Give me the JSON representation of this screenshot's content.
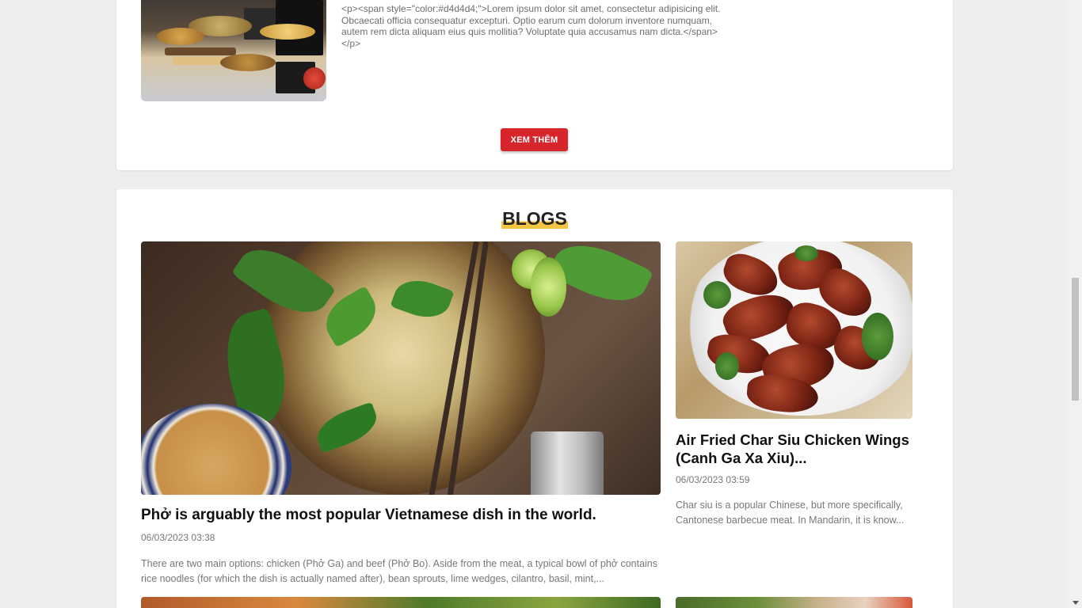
{
  "intro": {
    "text": "<p><span style=\"color:#d4d4d4;\">Lorem ipsum dolor sit amet, consectetur adipisicing elit. Obcaecati officia consequatur excepturi. Optio earum cum dolorum inventore numquam, autem rem dicta aliquam eius quis mollitia? Voluptate quia accusamus nam dicta.</span></p>",
    "more_label": "XEM THÊM"
  },
  "blogs": {
    "heading": "BLOGS",
    "featured": {
      "title": "Phở is arguably the most popular Vietnamese dish in the world.",
      "date": "06/03/2023 03:38",
      "excerpt": "There are two main options: chicken (Phở Ga) and beef (Phở Bo). Aside from the meat, a typical bowl of phở contains rice noodles (for which the dish is actually named after), bean sprouts, lime wedges, cilantro, basil, mint,..."
    },
    "side": {
      "title": "Air Fried Char Siu Chicken Wings (Canh Ga Xa Xiu)...",
      "date": "06/03/2023 03:59",
      "excerpt": "Char siu is a popular Chinese, but more specifically, Cantonese barbecue meat. In Mandarin, it is know..."
    }
  },
  "icons": {
    "scroll_down": "chevron-down-icon"
  }
}
